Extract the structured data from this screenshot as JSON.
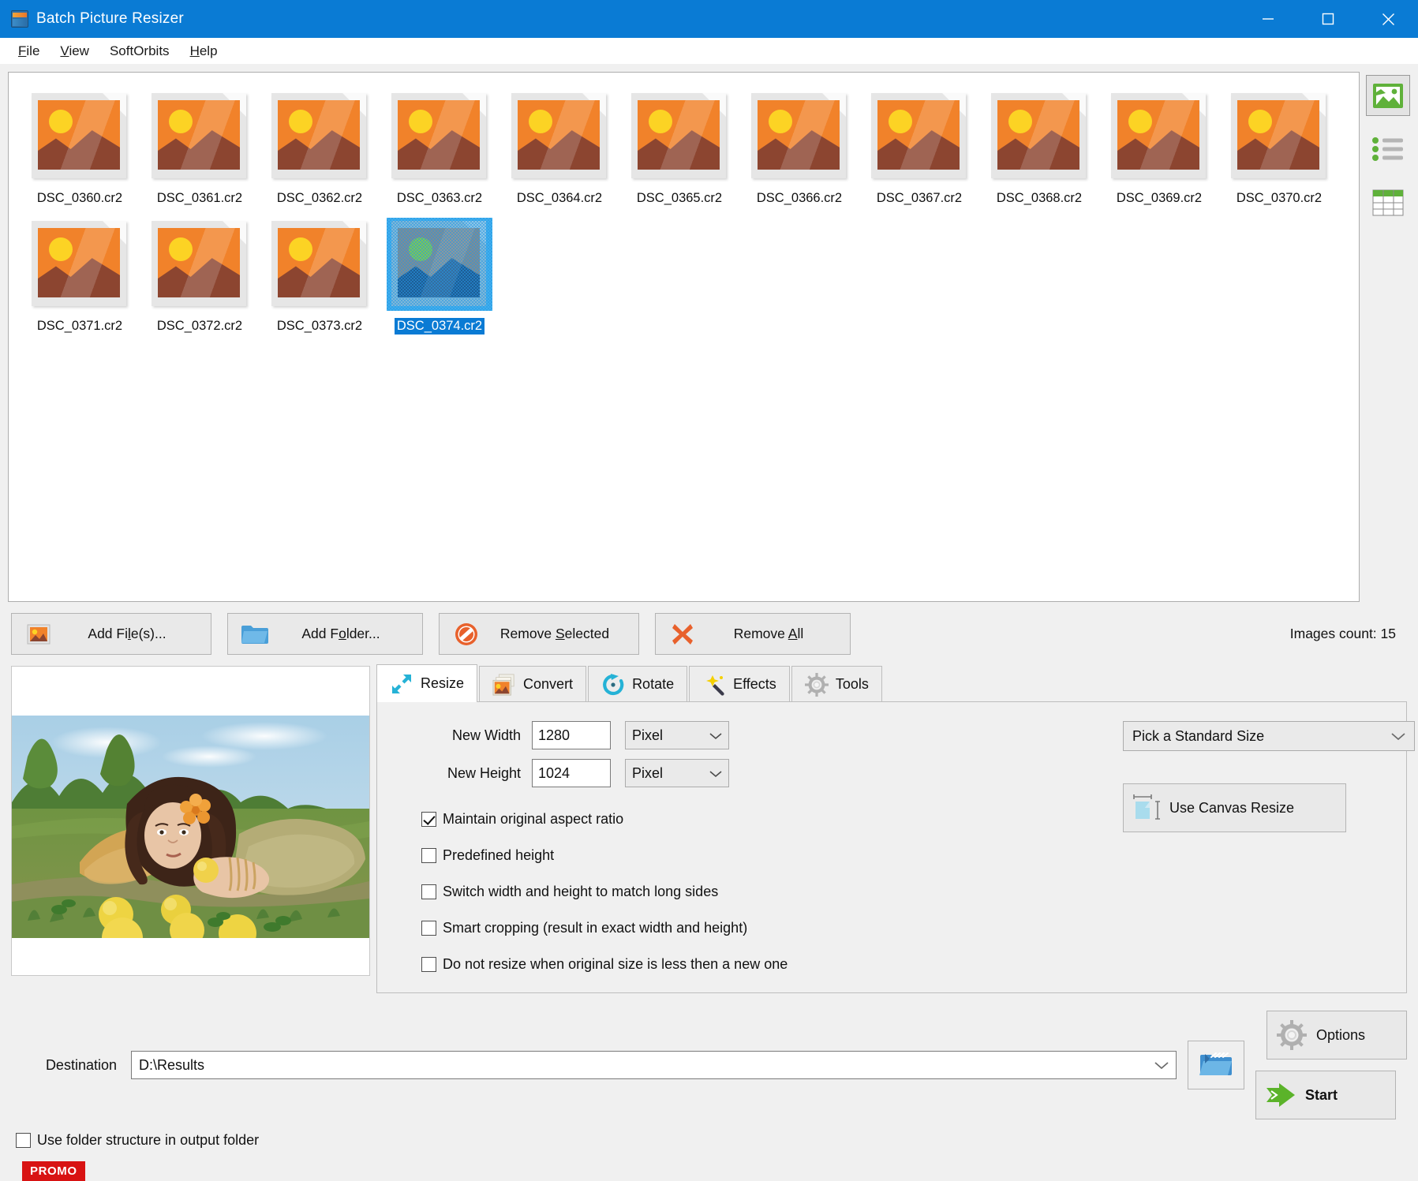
{
  "window": {
    "title": "Batch Picture Resizer",
    "app_icon": "picture-resizer-icon",
    "minimize": "minimize-icon",
    "maximize": "maximize-icon",
    "close": "close-icon"
  },
  "menu": {
    "items": [
      {
        "label": "File",
        "accel": "F"
      },
      {
        "label": "View",
        "accel": "V"
      },
      {
        "label": "SoftOrbits",
        "accel": ""
      },
      {
        "label": "Help",
        "accel": "H"
      }
    ]
  },
  "file_list": {
    "items": [
      {
        "name": "DSC_0360.cr2",
        "selected": false
      },
      {
        "name": "DSC_0361.cr2",
        "selected": false
      },
      {
        "name": "DSC_0362.cr2",
        "selected": false
      },
      {
        "name": "DSC_0363.cr2",
        "selected": false
      },
      {
        "name": "DSC_0364.cr2",
        "selected": false
      },
      {
        "name": "DSC_0365.cr2",
        "selected": false
      },
      {
        "name": "DSC_0366.cr2",
        "selected": false
      },
      {
        "name": "DSC_0367.cr2",
        "selected": false
      },
      {
        "name": "DSC_0368.cr2",
        "selected": false
      },
      {
        "name": "DSC_0369.cr2",
        "selected": false
      },
      {
        "name": "DSC_0370.cr2",
        "selected": false
      },
      {
        "name": "DSC_0371.cr2",
        "selected": false
      },
      {
        "name": "DSC_0372.cr2",
        "selected": false
      },
      {
        "name": "DSC_0373.cr2",
        "selected": false
      },
      {
        "name": "DSC_0374.cr2",
        "selected": true
      }
    ]
  },
  "view_modes": [
    {
      "icon": "thumbnail-view-icon",
      "active": true
    },
    {
      "icon": "list-view-icon",
      "active": false
    },
    {
      "icon": "table-view-icon",
      "active": false
    }
  ],
  "actions": {
    "add_files": {
      "label": "Add File(s)...",
      "accel": "l",
      "icon": "add-image-icon"
    },
    "add_folder": {
      "label": "Add Folder...",
      "accel": "o",
      "icon": "folder-icon"
    },
    "remove_selected": {
      "label": "Remove Selected",
      "accel": "S",
      "icon": "no-entry-icon"
    },
    "remove_all": {
      "label": "Remove All",
      "accel": "A",
      "icon": "red-cross-icon"
    },
    "images_count": "Images count: 15"
  },
  "tabs": [
    {
      "label": "Resize",
      "icon": "resize-arrows-icon",
      "active": true
    },
    {
      "label": "Convert",
      "icon": "convert-images-icon",
      "active": false
    },
    {
      "label": "Rotate",
      "icon": "rotate-circular-arrow-icon",
      "active": false
    },
    {
      "label": "Effects",
      "icon": "magic-wand-icon",
      "active": false
    },
    {
      "label": "Tools",
      "icon": "gear-icon",
      "active": false
    }
  ],
  "resize": {
    "new_width_label": "New Width",
    "new_width_value": "1280",
    "new_width_unit": "Pixel",
    "new_height_label": "New Height",
    "new_height_value": "1024",
    "new_height_unit": "Pixel",
    "standard_size": "Pick a Standard Size",
    "canvas_resize": "Use Canvas Resize",
    "checkboxes": [
      {
        "label": "Maintain original aspect ratio",
        "checked": true
      },
      {
        "label": "Predefined height",
        "checked": false
      },
      {
        "label": "Switch width and height to match long sides",
        "checked": false
      },
      {
        "label": "Smart cropping (result in exact width and height)",
        "checked": false
      },
      {
        "label": "Do not resize when original size is less then a new one",
        "checked": false
      }
    ]
  },
  "preview": {
    "name": "preview-image",
    "description": "Woman lying in grass with yellow apples"
  },
  "destination": {
    "label": "Destination",
    "value": "D:\\Results",
    "browse_icon": "browse-folder-icon",
    "use_folder_structure": {
      "label": "Use folder structure in output folder",
      "checked": false
    }
  },
  "footer": {
    "options": {
      "label": "Options",
      "icon": "gear-icon"
    },
    "start": {
      "label": "Start",
      "icon": "green-arrow-icon"
    },
    "promo": "PROMO"
  },
  "colors": {
    "title_bar": "#0a7bd4",
    "selection": "#0a7bd4",
    "promo": "#d81313",
    "start_arrow": "#5bb32a",
    "accent_cyan": "#1ba8cb"
  }
}
